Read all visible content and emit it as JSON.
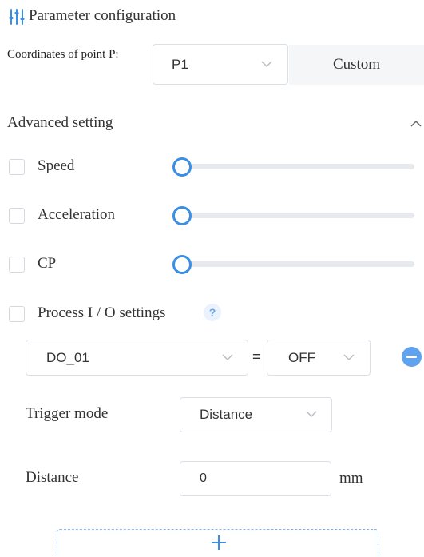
{
  "header": {
    "title": "Parameter configuration",
    "icon": "sliders-icon"
  },
  "coordinates": {
    "label": "Coordinates of point P:",
    "selected": "P1",
    "custom_label": "Custom"
  },
  "advanced": {
    "label": "Advanced setting",
    "expanded": true,
    "options": [
      {
        "label": "Speed",
        "checked": false,
        "slider_value": 0
      },
      {
        "label": "Acceleration",
        "checked": false,
        "slider_value": 0
      },
      {
        "label": "CP",
        "checked": false,
        "slider_value": 0
      }
    ]
  },
  "process_io": {
    "label": "Process I / O settings",
    "checked": false,
    "help_glyph": "?",
    "output": "DO_01",
    "equals": "=",
    "state": "OFF",
    "trigger_mode_label": "Trigger mode",
    "trigger_mode": "Distance",
    "distance_label": "Distance",
    "distance_value": "0",
    "distance_unit": "mm"
  },
  "colors": {
    "accent": "#3a8ee6",
    "border": "#dcdfe6",
    "track": "#e6e9ee"
  }
}
